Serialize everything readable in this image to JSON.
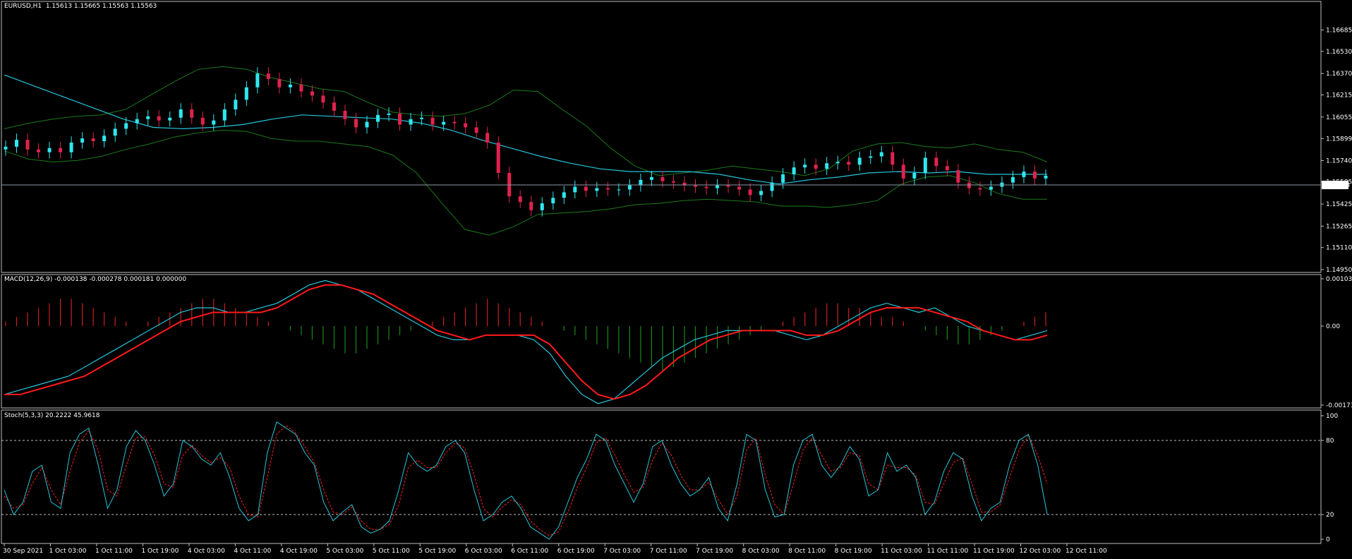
{
  "theme": {
    "background": "#000000",
    "axis": "#c0c0c0",
    "text": "#ffffff",
    "bull": "#2ee8f0",
    "bear": "#e0224e",
    "band": "#1c7a1c",
    "ma": "#26c6da",
    "macd_pos": "#cc1f1f",
    "macd_neg": "#1a8a1a",
    "signal": "#ff1a1a",
    "stoch_main": "#26c6da",
    "stoch_signal": "#ff2020"
  },
  "header": {
    "main": "EURUSD,H1  1.15613 1.15665 1.15563 1.15563",
    "macd": "MACD(12,26,9) -0.000138 -0.000278 0.000181 0.000000",
    "stoch": "Stoch(5,3,3) 20.2222 45.9618"
  },
  "chart_data": [
    {
      "type": "candlestick",
      "symbol": "EURUSD,H1",
      "ohlc_last": [
        1.15613,
        1.15665,
        1.15563,
        1.15563
      ],
      "current_price": "1.15563",
      "y_ticks": [
        "1.16685",
        "1.16530",
        "1.16370",
        "1.16215",
        "1.16055",
        "1.15899",
        "1.15740",
        "1.15585",
        "1.15425",
        "1.15265",
        "1.15110",
        "1.14950"
      ],
      "ylim": [
        1.1495,
        1.168
      ],
      "close_series_approx": [
        1.1584,
        1.1589,
        1.1582,
        1.158,
        1.1583,
        1.158,
        1.1587,
        1.159,
        1.1588,
        1.1592,
        1.1597,
        1.1601,
        1.1604,
        1.1606,
        1.1603,
        1.1605,
        1.1611,
        1.1605,
        1.16,
        1.1603,
        1.1611,
        1.1618,
        1.1627,
        1.1637,
        1.1633,
        1.1627,
        1.1629,
        1.1624,
        1.1621,
        1.1616,
        1.161,
        1.1604,
        1.1598,
        1.1602,
        1.1607,
        1.1608,
        1.16,
        1.1604,
        1.1605,
        1.16,
        1.1602,
        1.1601,
        1.1598,
        1.1594,
        1.1587,
        1.1565,
        1.1548,
        1.1544,
        1.1538,
        1.1543,
        1.1547,
        1.1551,
        1.1555,
        1.1552,
        1.1554,
        1.1553,
        1.1553,
        1.1556,
        1.156,
        1.1562,
        1.1559,
        1.1558,
        1.1556,
        1.1555,
        1.1554,
        1.1556,
        1.1555,
        1.1553,
        1.1549,
        1.1552,
        1.1558,
        1.1564,
        1.1569,
        1.1571,
        1.1568,
        1.1572,
        1.1573,
        1.1571,
        1.1576,
        1.1577,
        1.158,
        1.1571,
        1.1561,
        1.1565,
        1.1576,
        1.157,
        1.1567,
        1.1558,
        1.1554,
        1.1553,
        1.1555,
        1.1558,
        1.1562,
        1.1566,
        1.1561,
        1.1563
      ],
      "bollinger_upper_approx": [
        1.1597,
        1.1601,
        1.1604,
        1.1606,
        1.1607,
        1.1611,
        1.1621,
        1.1631,
        1.164,
        1.1642,
        1.164,
        1.1634,
        1.163,
        1.1626,
        1.1624,
        1.1616,
        1.1609,
        1.1607,
        1.1606,
        1.1608,
        1.1614,
        1.1625,
        1.1624,
        1.1611,
        1.1599,
        1.1583,
        1.157,
        1.1563,
        1.1565,
        1.1567,
        1.157,
        1.1568,
        1.1566,
        1.1563,
        1.1568,
        1.1581,
        1.1586,
        1.1587,
        1.1584,
        1.1583,
        1.1586,
        1.1582,
        1.158,
        1.1573
      ],
      "bollinger_lower_approx": [
        1.1581,
        1.1575,
        1.1573,
        1.1574,
        1.1577,
        1.1582,
        1.1586,
        1.1591,
        1.1594,
        1.1596,
        1.1595,
        1.159,
        1.1588,
        1.1588,
        1.1586,
        1.1584,
        1.1578,
        1.1565,
        1.1544,
        1.1524,
        1.152,
        1.1526,
        1.1535,
        1.1536,
        1.1537,
        1.1539,
        1.1542,
        1.1543,
        1.1545,
        1.1546,
        1.1545,
        1.1544,
        1.1541,
        1.1541,
        1.154,
        1.1542,
        1.1545,
        1.1557,
        1.1562,
        1.1563,
        1.1558,
        1.155,
        1.1546,
        1.1546
      ],
      "ma_approx": [
        1.1636,
        1.1628,
        1.162,
        1.1612,
        1.1604,
        1.1598,
        1.1597,
        1.1598,
        1.16,
        1.1604,
        1.1607,
        1.1606,
        1.1605,
        1.1604,
        1.1601,
        1.1596,
        1.1589,
        1.1583,
        1.1577,
        1.1572,
        1.1568,
        1.1566,
        1.1566,
        1.1566,
        1.1564,
        1.156,
        1.1557,
        1.156,
        1.1562,
        1.1565,
        1.1566,
        1.1565,
        1.1566,
        1.1564,
        1.1564,
        1.1564
      ]
    },
    {
      "type": "macd",
      "name": "MACD(12,26,9)",
      "values": [
        -0.000138,
        -0.000278,
        0.000181,
        0.0
      ],
      "y_ticks": [
        "0.001037",
        "0.00",
        "-0.001734"
      ],
      "ylim": [
        -0.001734,
        0.001037
      ],
      "histogram_approx": [
        0.0001,
        0.0002,
        0.0003,
        0.0004,
        0.0005,
        0.0006,
        0.0006,
        0.0005,
        0.0004,
        0.0003,
        0.0002,
        0.0001,
        0.0,
        0.0001,
        0.0002,
        0.0003,
        0.0004,
        0.0005,
        0.0006,
        0.0006,
        0.0005,
        0.0004,
        0.0003,
        0.0002,
        0.0001,
        0.0,
        -0.0001,
        -0.0002,
        -0.0003,
        -0.0004,
        -0.0005,
        -0.0006,
        -0.0006,
        -0.0005,
        -0.0004,
        -0.0003,
        -0.0002,
        -0.0001,
        0.0,
        0.0001,
        0.0002,
        0.0003,
        0.0004,
        0.0005,
        0.0006,
        0.0005,
        0.0004,
        0.0003,
        0.0002,
        0.0001,
        0.0,
        -0.0001,
        -0.0002,
        -0.0003,
        -0.0004,
        -0.0005,
        -0.0006,
        -0.0007,
        -0.0008,
        -0.0009,
        -0.001,
        -0.0009,
        -0.0008,
        -0.0007,
        -0.0006,
        -0.0005,
        -0.0004,
        -0.0003,
        -0.0002,
        -0.0001,
        0.0,
        0.0001,
        0.0002,
        0.0003,
        0.0004,
        0.0005,
        0.0005,
        0.0004,
        0.0004,
        0.0003,
        0.0002,
        0.0002,
        0.0001,
        0.0,
        -0.0001,
        -0.0002,
        -0.0003,
        -0.0004,
        -0.0004,
        -0.0003,
        -0.0002,
        -0.0001,
        0.0,
        0.0001,
        0.0002,
        0.0003
      ],
      "macd_line_approx": [
        -0.0015,
        -0.0014,
        -0.0013,
        -0.0012,
        -0.0011,
        -0.0009,
        -0.0007,
        -0.0005,
        -0.0003,
        -0.0001,
        0.0001,
        0.0003,
        0.0004,
        0.0004,
        0.0003,
        0.0003,
        0.0004,
        0.0005,
        0.0007,
        0.0009,
        0.001,
        0.0009,
        0.0008,
        0.0006,
        0.0004,
        0.0002,
        0.0,
        -0.0002,
        -0.0003,
        -0.0003,
        -0.0002,
        -0.0002,
        -0.0002,
        -0.0003,
        -0.0006,
        -0.0011,
        -0.0015,
        -0.0017,
        -0.0016,
        -0.0013,
        -0.001,
        -0.0007,
        -0.0005,
        -0.0003,
        -0.0002,
        -0.0001,
        -0.0001,
        -0.0001,
        -0.0001,
        -0.0002,
        -0.0003,
        -0.0002,
        0.0,
        0.0002,
        0.0004,
        0.0005,
        0.0004,
        0.0003,
        0.0004,
        0.0002,
        0.0,
        -0.0001,
        -0.0002,
        -0.0003,
        -0.0002,
        -0.0001
      ],
      "signal_line_approx": [
        -0.0015,
        -0.0015,
        -0.0014,
        -0.0013,
        -0.0012,
        -0.0011,
        -0.0009,
        -0.0007,
        -0.0005,
        -0.0003,
        -0.0001,
        0.0001,
        0.0002,
        0.0003,
        0.0003,
        0.0003,
        0.0003,
        0.0004,
        0.0006,
        0.0008,
        0.0009,
        0.0009,
        0.0008,
        0.0007,
        0.0005,
        0.0003,
        0.0001,
        -0.0001,
        -0.0002,
        -0.0003,
        -0.0002,
        -0.0002,
        -0.0002,
        -0.0002,
        -0.0004,
        -0.0008,
        -0.0012,
        -0.0015,
        -0.0016,
        -0.0015,
        -0.0013,
        -0.001,
        -0.0007,
        -0.0005,
        -0.0003,
        -0.0002,
        -0.0001,
        -0.0001,
        -0.0001,
        -0.0001,
        -0.0002,
        -0.0002,
        -0.0001,
        0.0001,
        0.0003,
        0.0004,
        0.0004,
        0.0004,
        0.0003,
        0.0002,
        0.0001,
        -0.0001,
        -0.0002,
        -0.0003,
        -0.0003,
        -0.0002
      ]
    },
    {
      "type": "stochastic",
      "name": "Stoch(5,3,3)",
      "values": [
        20.2222,
        45.9618
      ],
      "y_ticks": [
        "100",
        "80",
        "20",
        "0"
      ],
      "levels": [
        80,
        20
      ],
      "ylim": [
        0,
        100
      ],
      "main_approx": [
        40,
        20,
        30,
        55,
        60,
        30,
        25,
        70,
        85,
        90,
        60,
        25,
        40,
        75,
        88,
        80,
        60,
        35,
        45,
        80,
        75,
        65,
        60,
        70,
        50,
        25,
        15,
        20,
        70,
        95,
        90,
        85,
        70,
        60,
        30,
        15,
        22,
        28,
        10,
        5,
        8,
        15,
        40,
        70,
        60,
        55,
        60,
        75,
        80,
        70,
        40,
        15,
        20,
        30,
        35,
        25,
        10,
        5,
        0,
        10,
        30,
        50,
        65,
        85,
        80,
        60,
        45,
        30,
        45,
        75,
        80,
        60,
        45,
        35,
        40,
        50,
        25,
        15,
        45,
        85,
        80,
        40,
        18,
        20,
        60,
        80,
        85,
        60,
        50,
        60,
        75,
        65,
        35,
        40,
        70,
        55,
        60,
        50,
        20,
        30,
        55,
        70,
        65,
        35,
        15,
        25,
        30,
        60,
        80,
        85,
        60,
        20
      ],
      "signal_approx": [
        35,
        25,
        28,
        45,
        58,
        40,
        28,
        55,
        78,
        88,
        72,
        40,
        35,
        60,
        82,
        83,
        68,
        45,
        42,
        68,
        76,
        68,
        62,
        66,
        58,
        35,
        20,
        18,
        50,
        85,
        92,
        86,
        75,
        62,
        40,
        22,
        20,
        26,
        15,
        8,
        8,
        12,
        28,
        58,
        64,
        58,
        58,
        70,
        78,
        74,
        52,
        25,
        18,
        26,
        32,
        28,
        15,
        8,
        3,
        6,
        22,
        42,
        58,
        78,
        82,
        68,
        52,
        38,
        42,
        64,
        78,
        68,
        52,
        40,
        40,
        46,
        32,
        20,
        35,
        72,
        82,
        52,
        28,
        20,
        45,
        72,
        82,
        68,
        55,
        58,
        70,
        68,
        45,
        40,
        60,
        58,
        58,
        52,
        30,
        28,
        45,
        62,
        66,
        45,
        22,
        22,
        28,
        50,
        72,
        84,
        68,
        45
      ]
    }
  ],
  "time_axis": [
    "30 Sep 2021",
    "1 Oct 03:00",
    "1 Oct 11:00",
    "1 Oct 19:00",
    "4 Oct 03:00",
    "4 Oct 11:00",
    "4 Oct 19:00",
    "5 Oct 03:00",
    "5 Oct 11:00",
    "5 Oct 19:00",
    "6 Oct 03:00",
    "6 Oct 11:00",
    "6 Oct 19:00",
    "7 Oct 03:00",
    "7 Oct 11:00",
    "7 Oct 19:00",
    "8 Oct 03:00",
    "8 Oct 11:00",
    "8 Oct 19:00",
    "11 Oct 03:00",
    "11 Oct 11:00",
    "11 Oct 19:00",
    "12 Oct 03:00",
    "12 Oct 11:00"
  ]
}
